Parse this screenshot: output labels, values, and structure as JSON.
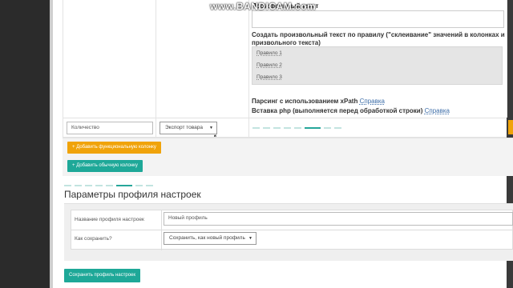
{
  "watermark": "www.BANDICAM.com",
  "upper": {
    "custom_text_title": "Произвольный текст",
    "rule_title": "Создать произвольный текст по правилу (\"склеивание\" значений в колонках и призвольного текста)",
    "rules": [
      "Правило 1",
      "Правило 2",
      "Правило 3"
    ],
    "xpath_title": "Парсинг с использованием xPath",
    "php_title": "Вставка php (выполняется перед обработкой строки)",
    "help_link": "Справка"
  },
  "row": {
    "field_value": "Количество",
    "select_value": "Экспорт товара"
  },
  "buttons": {
    "add_functional": "Добавить функциональную колонку",
    "add_regular": "Добавить обычную колонку",
    "plus_symbol": "+"
  },
  "settings": {
    "title": "Параметры профиля настроек",
    "name_label": "Название профиля настроек",
    "name_value": "Новый профиль",
    "save_label": "Как сохранить?",
    "save_select": "Сохранить, как новый профиль",
    "save_button": "Сохранить профиль настроек"
  },
  "colors": {
    "teal": "#1ea898",
    "orange": "#f0a30a"
  }
}
